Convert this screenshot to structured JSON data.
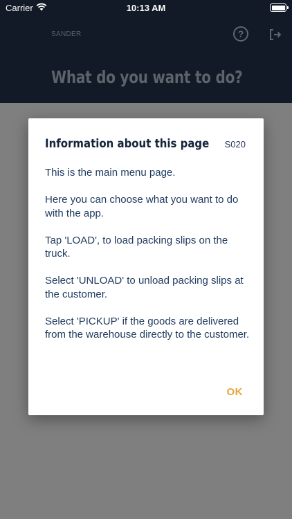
{
  "status_bar": {
    "carrier": "Carrier",
    "time": "10:13 AM"
  },
  "header": {
    "user": "SANDER",
    "title": "What do you want to do?",
    "help_icon": "question-circle-icon",
    "logout_icon": "logout-icon"
  },
  "dialog": {
    "title": "Information about this page",
    "code": "S020",
    "paragraphs": [
      "This is the main menu page.",
      "Here you can choose what you want to do with the app.",
      "Tap 'LOAD', to load packing slips on the truck.",
      "Select 'UNLOAD' to unload packing slips at the customer.",
      "Select 'PICKUP' if the goods are delivered from the warehouse directly to the customer."
    ],
    "ok_label": "OK"
  },
  "colors": {
    "header_bg": "#111a26",
    "overlay": "#7f7f7f",
    "accent": "#e8a33a",
    "dialog_text": "#1e3a5f"
  }
}
